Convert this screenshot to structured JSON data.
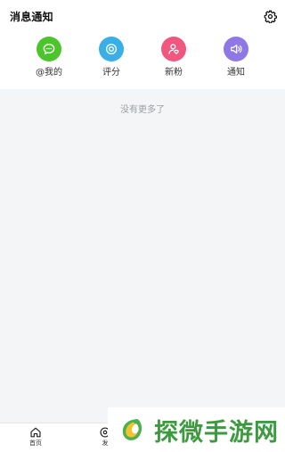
{
  "header": {
    "title": "消息通知",
    "settings_icon": "gear-icon"
  },
  "categories": [
    {
      "label": "@我的",
      "icon": "chat-bubble-icon",
      "color": "#4cc42b"
    },
    {
      "label": "评分",
      "icon": "target-icon",
      "color": "#3aaee6"
    },
    {
      "label": "新粉",
      "icon": "user-heart-icon",
      "color": "#f0567e"
    },
    {
      "label": "通知",
      "icon": "megaphone-icon",
      "color": "#8f77e8"
    }
  ],
  "content": {
    "empty_text": "没有更多了",
    "background": "#f4f5f7"
  },
  "tabbar": {
    "tabs": [
      {
        "label": "首页",
        "icon": "home-icon"
      },
      {
        "label": "发",
        "icon": "discover-icon"
      }
    ]
  },
  "watermark": {
    "text": "探微手游网"
  }
}
